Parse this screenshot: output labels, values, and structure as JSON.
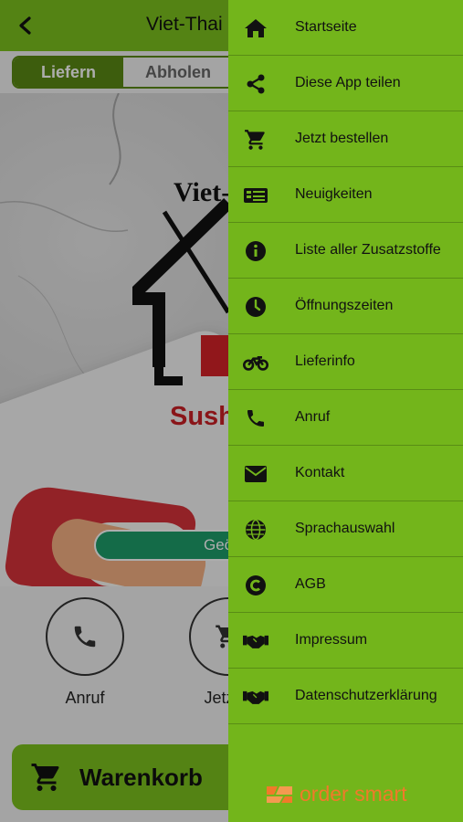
{
  "header": {
    "title": "Viet-Thai S"
  },
  "mode_tabs": [
    {
      "label": "Liefern",
      "active": true
    },
    {
      "label": "Abholen",
      "active": false
    }
  ],
  "hero": {
    "logo_top": "Viet-",
    "logo_bottom": "Sushi",
    "status_pill": "Geö"
  },
  "actions": [
    {
      "label": "Anruf",
      "icon": "phone-icon"
    },
    {
      "label": "Jetzt b",
      "icon": "cart-icon"
    }
  ],
  "cart_button": {
    "label": "Warenkorb"
  },
  "menu": {
    "items": [
      {
        "label": "Startseite",
        "icon": "home-icon"
      },
      {
        "label": "Diese App teilen",
        "icon": "share-icon"
      },
      {
        "label": "Jetzt bestellen",
        "icon": "cart-icon"
      },
      {
        "label": "Neuigkeiten",
        "icon": "news-icon"
      },
      {
        "label": "Liste aller Zusatzstoffe",
        "icon": "info-icon"
      },
      {
        "label": "Öffnungszeiten",
        "icon": "clock-icon"
      },
      {
        "label": "Lieferinfo",
        "icon": "motorcycle-icon"
      },
      {
        "label": "Anruf",
        "icon": "phone-icon"
      },
      {
        "label": "Kontakt",
        "icon": "envelope-icon"
      },
      {
        "label": "Sprachauswahl",
        "icon": "globe-icon"
      },
      {
        "label": "AGB",
        "icon": "copyright-icon"
      },
      {
        "label": "Impressum",
        "icon": "handshake-icon"
      },
      {
        "label": "Datenschutzerklärung",
        "icon": "handshake-icon"
      }
    ],
    "brand": "order smart"
  },
  "colors": {
    "topbar": "#7cc21e",
    "drawer": "#73b51b",
    "segment_active": "#5a8a14",
    "brand_orange": "#f07a2a"
  }
}
